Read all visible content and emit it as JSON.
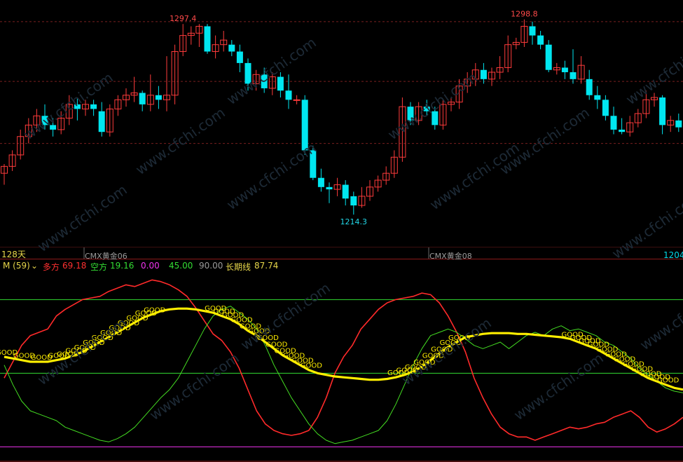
{
  "colors": {
    "up": "#ff3b3b",
    "down": "#00e6f0",
    "bull": "#ff2a2a",
    "bear": "#44dd22",
    "long": "#ffee00",
    "zero": "#ee33ee",
    "refHigh": "#33dd33",
    "refMid": "#33dd33",
    "grid": "#7a1f1f",
    "frame": "#8b1a1a",
    "watermark": "#1d2a36"
  },
  "labels": {
    "period": "128天",
    "contract_left": "CMX黄金06",
    "contract_right": "CMX黄金08",
    "high1": "1297.4",
    "high2": "1298.8",
    "low1": "1214.3",
    "low_edge": "1204",
    "watermark": "www.cfchi.com",
    "good": "GOOD"
  },
  "indicator_header": {
    "name": "M (59)",
    "bull_label": "多方",
    "bull_value": "69.18",
    "bear_label": "空方",
    "bear_value": "19.16",
    "ref_zero": "0.00",
    "ref_mid": "45.00",
    "ref_high": "90.00",
    "long_label": "长期线",
    "long_value": "87.74"
  },
  "chart_data": [
    {
      "type": "candlestick",
      "title": "CMX黄金",
      "ylim": [
        1200,
        1305
      ],
      "gridlines": [
        1245,
        1272,
        1298
      ],
      "candles": [
        [
          1232,
          1235,
          1227,
          1236
        ],
        [
          1235,
          1240,
          1233,
          1242
        ],
        [
          1240,
          1248,
          1238,
          1251
        ],
        [
          1248,
          1253,
          1245,
          1256
        ],
        [
          1253,
          1257,
          1250,
          1260
        ],
        [
          1257,
          1253,
          1251,
          1262
        ],
        [
          1253,
          1251,
          1248,
          1256
        ],
        [
          1251,
          1256,
          1249,
          1259
        ],
        [
          1256,
          1262,
          1253,
          1266
        ],
        [
          1262,
          1260,
          1255,
          1265
        ],
        [
          1260,
          1262,
          1257,
          1264
        ],
        [
          1262,
          1260,
          1257,
          1264
        ],
        [
          1259,
          1250,
          1248,
          1263
        ],
        [
          1250,
          1260,
          1248,
          1262
        ],
        [
          1260,
          1264,
          1257,
          1266
        ],
        [
          1264,
          1266,
          1261,
          1269
        ],
        [
          1266,
          1267,
          1263,
          1274
        ],
        [
          1267,
          1262,
          1259,
          1268
        ],
        [
          1262,
          1266,
          1259,
          1275
        ],
        [
          1266,
          1264,
          1260,
          1270
        ],
        [
          1264,
          1266,
          1259,
          1283
        ],
        [
          1266,
          1285,
          1262,
          1288
        ],
        [
          1285,
          1292,
          1283,
          1297
        ],
        [
          1292,
          1293,
          1288,
          1296
        ],
        [
          1293,
          1296,
          1287,
          1297
        ],
        [
          1296,
          1285,
          1284,
          1297
        ],
        [
          1285,
          1288,
          1282,
          1292
        ],
        [
          1288,
          1290,
          1285,
          1294
        ],
        [
          1288,
          1285,
          1283,
          1290
        ],
        [
          1285,
          1280,
          1276,
          1288
        ],
        [
          1280,
          1271,
          1268,
          1282
        ],
        [
          1271,
          1275,
          1268,
          1277
        ],
        [
          1275,
          1269,
          1267,
          1278
        ],
        [
          1269,
          1274,
          1266,
          1276
        ],
        [
          1274,
          1268,
          1265,
          1276
        ],
        [
          1268,
          1264,
          1260,
          1275
        ],
        [
          1264,
          1264,
          1262,
          1266
        ],
        [
          1264,
          1242,
          1240,
          1266
        ],
        [
          1242,
          1230,
          1229,
          1244
        ],
        [
          1230,
          1226,
          1224,
          1234
        ],
        [
          1226,
          1225,
          1219,
          1228
        ],
        [
          1225,
          1227,
          1222,
          1230
        ],
        [
          1227,
          1221,
          1218,
          1229
        ],
        [
          1222,
          1218,
          1214,
          1224
        ],
        [
          1218,
          1222,
          1217,
          1226
        ],
        [
          1222,
          1226,
          1220,
          1229
        ],
        [
          1226,
          1229,
          1224,
          1231
        ],
        [
          1229,
          1232,
          1227,
          1235
        ],
        [
          1232,
          1239,
          1230,
          1242
        ],
        [
          1239,
          1261,
          1237,
          1265
        ],
        [
          1261,
          1255,
          1253,
          1263
        ],
        [
          1255,
          1261,
          1253,
          1263
        ],
        [
          1261,
          1259,
          1257,
          1264
        ],
        [
          1259,
          1253,
          1251,
          1261
        ],
        [
          1253,
          1262,
          1251,
          1264
        ],
        [
          1262,
          1263,
          1259,
          1265
        ],
        [
          1263,
          1270,
          1260,
          1273
        ],
        [
          1270,
          1273,
          1267,
          1276
        ],
        [
          1273,
          1277,
          1270,
          1280
        ],
        [
          1277,
          1273,
          1271,
          1280
        ],
        [
          1273,
          1276,
          1270,
          1278
        ],
        [
          1276,
          1278,
          1273,
          1283
        ],
        [
          1278,
          1288,
          1276,
          1292
        ],
        [
          1288,
          1289,
          1286,
          1291
        ],
        [
          1289,
          1296,
          1287,
          1299
        ],
        [
          1296,
          1292,
          1288,
          1298
        ],
        [
          1292,
          1288,
          1286,
          1294
        ],
        [
          1288,
          1277,
          1276,
          1290
        ],
        [
          1277,
          1278,
          1275,
          1280
        ],
        [
          1278,
          1276,
          1273,
          1281
        ],
        [
          1276,
          1273,
          1271,
          1286
        ],
        [
          1273,
          1279,
          1271,
          1283
        ],
        [
          1273,
          1266,
          1264,
          1277
        ],
        [
          1266,
          1264,
          1260,
          1270
        ],
        [
          1264,
          1257,
          1255,
          1266
        ],
        [
          1257,
          1251,
          1249,
          1261
        ],
        [
          1251,
          1250,
          1249,
          1256
        ],
        [
          1250,
          1254,
          1248,
          1257
        ],
        [
          1254,
          1258,
          1252,
          1260
        ],
        [
          1258,
          1264,
          1256,
          1268
        ],
        [
          1264,
          1265,
          1261,
          1267
        ],
        [
          1265,
          1253,
          1249,
          1266
        ],
        [
          1253,
          1255,
          1250,
          1257
        ],
        [
          1255,
          1252,
          1250,
          1258
        ],
        [
          1252,
          1251,
          1248,
          1259
        ],
        [
          1251,
          1231,
          1229,
          1253
        ],
        [
          1231,
          1234,
          1230,
          1236
        ],
        [
          1234,
          1236,
          1232,
          1238
        ],
        [
          1236,
          1232,
          1230,
          1237
        ],
        [
          1232,
          1219,
          1214,
          1234
        ],
        [
          1219,
          1223,
          1218,
          1226
        ]
      ],
      "high_marks": [
        {
          "i": 22,
          "label": "1297.4"
        },
        {
          "i": 64,
          "label": "1298.8"
        }
      ],
      "low_marks": [
        {
          "i": 43,
          "label": "1214.3"
        }
      ]
    },
    {
      "type": "line",
      "title": "M (59)",
      "ylim": [
        -2,
        106
      ],
      "reference_lines": [
        0,
        45,
        90
      ],
      "series": [
        {
          "name": "多方",
          "values": [
            42,
            52,
            62,
            68,
            70,
            72,
            80,
            84,
            87,
            90,
            91,
            92,
            95,
            97,
            99,
            98,
            100,
            102,
            101,
            99,
            96,
            92,
            85,
            77,
            69,
            65,
            58,
            48,
            35,
            22,
            14,
            10,
            8,
            7,
            8,
            10,
            18,
            30,
            45,
            55,
            62,
            72,
            78,
            84,
            88,
            90,
            91,
            92,
            94,
            93,
            88,
            80,
            70,
            58,
            42,
            30,
            20,
            12,
            8,
            6,
            6,
            4,
            6,
            8,
            10,
            12,
            11,
            12,
            14,
            15,
            18,
            20,
            22,
            18,
            12,
            9,
            11,
            14,
            18
          ]
        },
        {
          "name": "空方",
          "values": [
            50,
            38,
            28,
            22,
            20,
            18,
            16,
            12,
            10,
            8,
            6,
            4,
            3,
            5,
            8,
            12,
            18,
            24,
            30,
            35,
            42,
            52,
            62,
            72,
            80,
            84,
            86,
            82,
            78,
            72,
            62,
            50,
            40,
            30,
            22,
            14,
            8,
            4,
            2,
            3,
            4,
            6,
            8,
            10,
            16,
            26,
            38,
            50,
            60,
            68,
            70,
            72,
            70,
            66,
            62,
            60,
            62,
            64,
            60,
            64,
            68,
            70,
            68,
            72,
            74,
            71,
            72,
            70,
            68,
            64,
            62,
            58,
            54,
            48,
            44,
            40,
            36,
            34,
            33
          ]
        },
        {
          "name": "长期线",
          "values": [
            55,
            54,
            53,
            52,
            52,
            52,
            53,
            54,
            56,
            58,
            61,
            64,
            67,
            70,
            73,
            76,
            79,
            81,
            83,
            84,
            84.5,
            84.5,
            84,
            83,
            82,
            80,
            78,
            75,
            71,
            68,
            64,
            60,
            56,
            53,
            50,
            47,
            45,
            44,
            43,
            42.5,
            42,
            41.5,
            41,
            41,
            41.5,
            42.5,
            44,
            46,
            49,
            53,
            57,
            61,
            64,
            67,
            68,
            69,
            69.5,
            69.5,
            69.5,
            69,
            69,
            68.5,
            68,
            67.5,
            67,
            66,
            64,
            62,
            60,
            57,
            54,
            51,
            48,
            45,
            42,
            40,
            38,
            36,
            35
          ]
        }
      ]
    }
  ]
}
